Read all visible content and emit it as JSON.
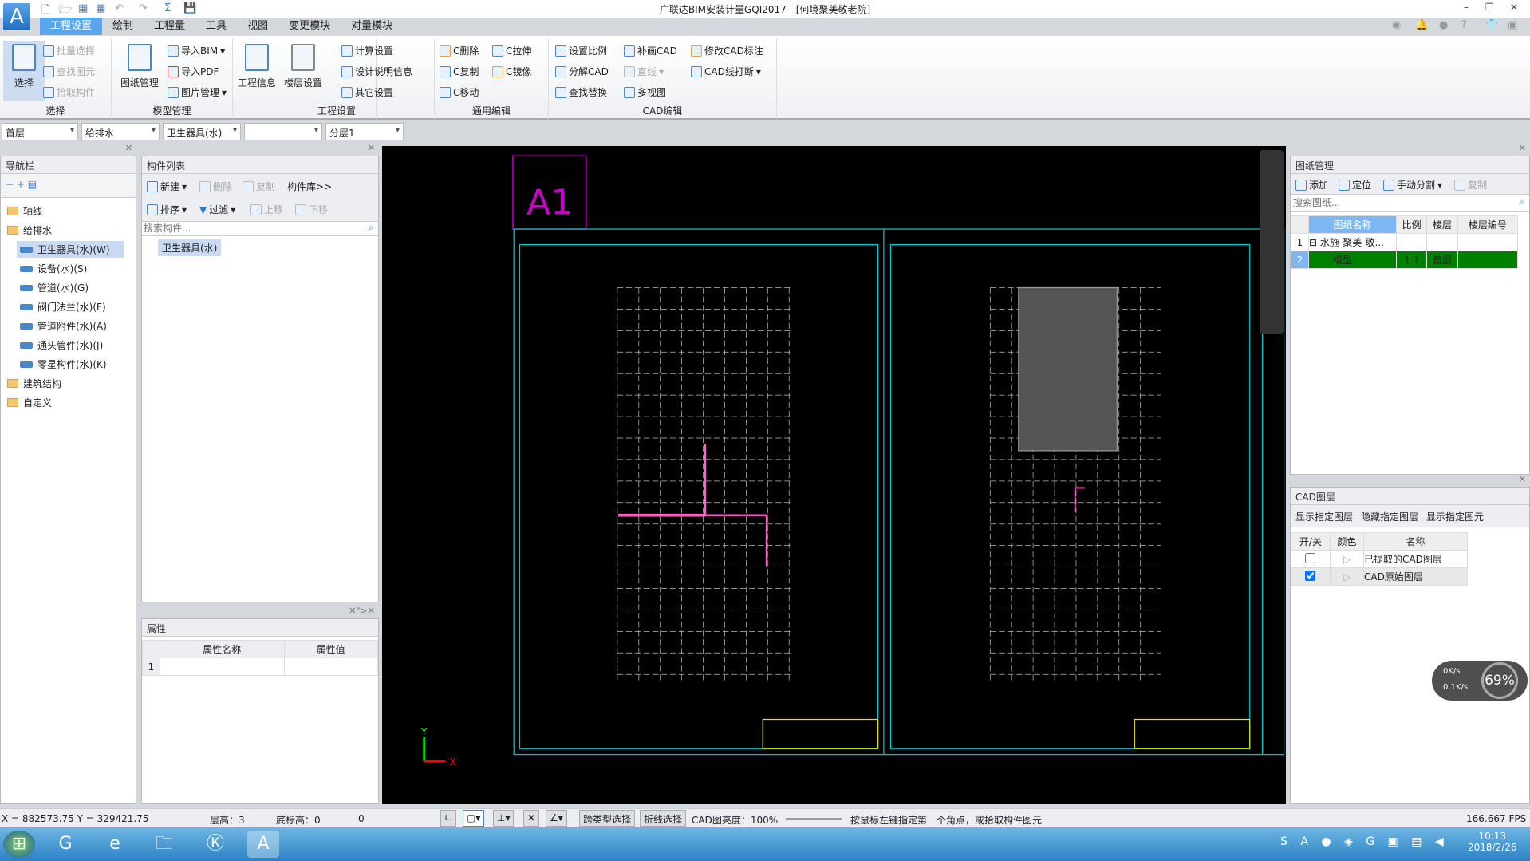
{
  "app": {
    "title": "广联达BIM安装计量GQI2017 - [何境聚美敬老院]",
    "logo": "A"
  },
  "quick_access": [
    "new-file-icon",
    "open-icon",
    "gq-export-icon",
    "bim-export-icon",
    "undo-icon",
    "redo-icon",
    "sum-icon",
    "save-icon"
  ],
  "tabs": [
    "工程设置",
    "绘制",
    "工程量",
    "工具",
    "视图",
    "变更模块",
    "对量模块"
  ],
  "ribbon": {
    "select": {
      "label": "选择",
      "big": "选择",
      "items": [
        "批量选择",
        "查找图元",
        "拾取构件"
      ]
    },
    "model": {
      "label": "模型管理",
      "big": "图纸管理",
      "items": [
        "导入BIM",
        "导入PDF",
        "图片管理"
      ]
    },
    "project": {
      "label": "工程设置",
      "big1": "工程信息",
      "big2": "楼层设置",
      "items": [
        "计算设置",
        "设计说明信息",
        "其它设置"
      ]
    },
    "edit": {
      "label": "通用编辑",
      "items": [
        "C删除",
        "C拉伸",
        "C复制",
        "C镜像",
        "C移动"
      ]
    },
    "cad": {
      "label": "CAD编辑",
      "items": [
        "设置比例",
        "补画CAD",
        "修改CAD标注",
        "分解CAD",
        "直线",
        "CAD线打断",
        "查找替换",
        "多视图"
      ]
    }
  },
  "combos": [
    "首层",
    "给排水",
    "卫生器具(水)",
    "",
    "分层1"
  ],
  "nav": {
    "title": "导航栏",
    "items": [
      {
        "label": "轴线",
        "type": "folder"
      },
      {
        "label": "给排水",
        "type": "folder"
      },
      {
        "label": "卫生器具(水)(W)",
        "type": "child",
        "selected": true
      },
      {
        "label": "设备(水)(S)",
        "type": "child"
      },
      {
        "label": "管道(水)(G)",
        "type": "child"
      },
      {
        "label": "阀门法兰(水)(F)",
        "type": "child"
      },
      {
        "label": "管道附件(水)(A)",
        "type": "child"
      },
      {
        "label": "通头管件(水)(J)",
        "type": "child"
      },
      {
        "label": "零星构件(水)(K)",
        "type": "child"
      },
      {
        "label": "建筑结构",
        "type": "folder"
      },
      {
        "label": "自定义",
        "type": "folder"
      }
    ]
  },
  "components": {
    "title": "构件列表",
    "toolbar1": [
      "新建",
      "删除",
      "复制",
      "构件库>>"
    ],
    "toolbar2": [
      "排序",
      "过滤",
      "上移",
      "下移"
    ],
    "search_placeholder": "搜索构件...",
    "items": [
      "卫生器具(水)"
    ]
  },
  "properties": {
    "title": "属性",
    "headers": [
      "属性名称",
      "属性值"
    ],
    "rows": [
      [
        "1",
        "",
        ""
      ]
    ]
  },
  "drawings": {
    "title": "图纸管理",
    "toolbar": [
      "添加",
      "定位",
      "手动分割",
      "复制"
    ],
    "search_placeholder": "搜索图纸...",
    "headers": [
      "图纸名称",
      "比例",
      "楼层",
      "楼层编号"
    ],
    "rows": [
      {
        "no": "1",
        "name": "水施-聚美-敬...",
        "scale": "",
        "floor": "",
        "code": ""
      },
      {
        "no": "2",
        "name": "模型",
        "scale": "1:1",
        "floor": "首层",
        "code": ""
      }
    ]
  },
  "cad_layers": {
    "title": "CAD图层",
    "toolbar": [
      "显示指定图层",
      "隐藏指定图层",
      "显示指定图元"
    ],
    "headers": [
      "开/关",
      "颜色",
      "名称"
    ],
    "rows": [
      {
        "checked": false,
        "name": "已提取的CAD图层"
      },
      {
        "checked": true,
        "name": "CAD原始图层"
      }
    ]
  },
  "canvas": {
    "sheet_label": "A1",
    "axis_x": "X",
    "axis_y": "Y",
    "colors": {
      "frame": "#00c8c8",
      "sheet": "#c800c8",
      "lines": "#bbbbbb",
      "pipe": "#ff66cc",
      "title_block": "#e6e600"
    }
  },
  "network": {
    "up": "0K/s",
    "down": "0.1K/s",
    "percent": "69%"
  },
  "status": {
    "coords": "X = 882573.75 Y = 329421.75",
    "floor_height": "层高：3",
    "bottom_elev": "底标高：0",
    "value": "0",
    "btn1": "跨类型选择",
    "btn2": "折线选择",
    "brightness": "CAD图亮度：100%",
    "hint": "按鼠标左键指定第一个角点，或拾取构件图元",
    "fps": "166.667 FPS"
  },
  "taskbar": {
    "time": "10:13",
    "date": "2018/2/26",
    "apps": [
      "start-icon",
      "glodon-icon",
      "ie-icon",
      "explorer-icon",
      "k-app-icon",
      "gqi-app-icon"
    ]
  }
}
